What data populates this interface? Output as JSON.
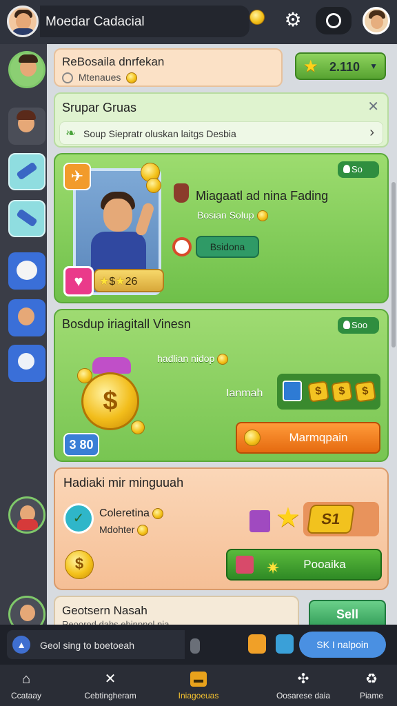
{
  "header": {
    "title": "Moedar Cadacial"
  },
  "cards": {
    "a": {
      "title": "ReBosaila dnrfekan",
      "sub": "Mtenaues"
    },
    "star_value": "2.110",
    "b": {
      "title": "Srupar Gruas",
      "row": "Soup Siepratr oluskan laitgs Desbia"
    },
    "c": {
      "badge": "So",
      "stars": "26",
      "title": "Miagaatl ad nina Fading",
      "sub": "Bosian Solup",
      "button": "Bsidona"
    },
    "d": {
      "title": "Bosdup iriagitall Vinesn",
      "badge": "Soo",
      "sub": "hadlian nidop",
      "count": "3 80",
      "label": "Ianmah",
      "button": "Marmqpain"
    },
    "e": {
      "title": "Hadiaki mir minguuah",
      "line1": "Coleretina",
      "line2": "Mdohter",
      "reward": "S1",
      "button": "Pooaika"
    },
    "f": {
      "title": "Geotsern Nasah",
      "sub": "Reoorod dahs ebinpnol nia",
      "sell": "Sell"
    }
  },
  "chat": {
    "placeholder": "Geol sing to boetoeah",
    "button": "SK I nalpoin"
  },
  "nav": [
    {
      "label": "Ccataay",
      "icon": "home-icon"
    },
    {
      "label": "Cebtingheram",
      "icon": "tools-icon"
    },
    {
      "label": "Iniagoeuas",
      "icon": "chest-icon",
      "active": true
    },
    {
      "label": "Oosarese daia",
      "icon": "puzzle-icon"
    },
    {
      "label": "Piame",
      "icon": "recycle-icon"
    }
  ],
  "colors": {
    "green_card": "#9ddc6f",
    "orange_card": "#fbd7b8",
    "accent_orange": "#ff9b3a",
    "accent_blue": "#4a90e2",
    "nav_active": "#f4c230"
  }
}
